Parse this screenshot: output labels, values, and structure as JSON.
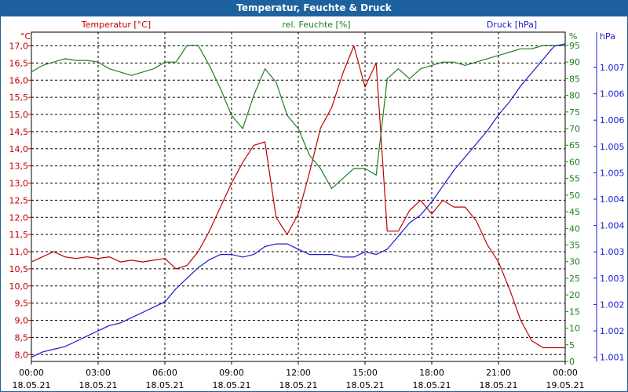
{
  "window": {
    "title": "Temperatur, Feuchte & Druck"
  },
  "colors": {
    "temperature": "#c00000",
    "humidity": "#1f7f1f",
    "pressure": "#1a1acf",
    "titlebar": "#1d619e",
    "grid": "#000000"
  },
  "chart_data": {
    "type": "line",
    "title": "Temperatur, Feuchte & Druck",
    "x_ticks": [
      {
        "time": "00:00",
        "date": "18.05.21"
      },
      {
        "time": "03:00",
        "date": "18.05.21"
      },
      {
        "time": "06:00",
        "date": "18.05.21"
      },
      {
        "time": "09:00",
        "date": "18.05.21"
      },
      {
        "time": "12:00",
        "date": "18.05.21"
      },
      {
        "time": "15:00",
        "date": "18.05.21"
      },
      {
        "time": "18:00",
        "date": "18.05.21"
      },
      {
        "time": "21:00",
        "date": "18.05.21"
      },
      {
        "time": "00:00",
        "date": "19.05.21"
      }
    ],
    "axes": {
      "temperature": {
        "label": "Temperatur [°C]",
        "unit": "°C",
        "ylim": [
          7.8,
          17.4
        ],
        "ticks": [
          "8,0",
          "8,5",
          "9,0",
          "9,5",
          "10,0",
          "10,5",
          "11,0",
          "11,5",
          "12,0",
          "12,5",
          "13,0",
          "13,5",
          "14,0",
          "14,5",
          "15,0",
          "15,5",
          "16,0",
          "16,5",
          "17,0"
        ]
      },
      "humidity": {
        "label": "rel. Feuchte [%]",
        "unit": "%",
        "ylim": [
          0,
          99
        ],
        "ticks": [
          "0",
          "5",
          "10",
          "15",
          "20",
          "25",
          "30",
          "35",
          "40",
          "45",
          "50",
          "55",
          "60",
          "65",
          "70",
          "75",
          "80",
          "85",
          "90",
          "95"
        ]
      },
      "pressure": {
        "label": "Druck [hPa]",
        "unit": "hPa",
        "ylim": [
          1000.92,
          1007.17
        ],
        "ticks": [
          "1.001",
          "1.002",
          "1.002",
          "1.003",
          "1.003",
          "1.004",
          "1.004",
          "1.005",
          "1.005",
          "1.006",
          "1.006",
          "1.007"
        ]
      }
    },
    "x_unit": "hours since 18.05.21 00:00",
    "grid": true,
    "series": [
      {
        "name": "Temperatur [°C]",
        "axis": "temperature",
        "x": [
          0,
          0.5,
          1,
          1.5,
          2,
          2.5,
          3,
          3.5,
          4,
          4.5,
          5,
          5.5,
          6,
          6.5,
          7,
          7.5,
          8,
          8.5,
          9,
          9.5,
          10,
          10.5,
          11,
          11.5,
          12,
          12.5,
          13,
          13.5,
          14,
          14.5,
          15,
          15.5,
          16,
          16.5,
          17,
          17.5,
          18,
          18.5,
          19,
          19.5,
          20,
          20.5,
          21,
          21.5,
          22,
          22.5,
          23,
          23.5,
          24
        ],
        "y": [
          10.7,
          10.85,
          11.0,
          10.85,
          10.8,
          10.85,
          10.8,
          10.85,
          10.7,
          10.75,
          10.7,
          10.75,
          10.8,
          10.5,
          10.6,
          11.0,
          11.6,
          12.3,
          13.0,
          13.6,
          14.1,
          14.2,
          12.0,
          11.5,
          12.1,
          13.3,
          14.6,
          15.2,
          16.2,
          17.0,
          15.8,
          16.5,
          11.6,
          11.6,
          12.2,
          12.5,
          12.1,
          12.5,
          12.3,
          12.3,
          11.9,
          11.2,
          10.7,
          9.9,
          9.0,
          8.4,
          8.2,
          8.2,
          8.2
        ]
      },
      {
        "name": "rel. Feuchte [%]",
        "axis": "humidity",
        "x": [
          0,
          0.5,
          1,
          1.5,
          2,
          2.5,
          3,
          3.5,
          4,
          4.5,
          5,
          5.5,
          6,
          6.5,
          7,
          7.5,
          8,
          8.5,
          9,
          9.5,
          10,
          10.5,
          11,
          11.5,
          12,
          12.5,
          13,
          13.5,
          14,
          14.5,
          15,
          15.5,
          16,
          16.5,
          17,
          17.5,
          18,
          18.5,
          19,
          19.5,
          20,
          20.5,
          21,
          21.5,
          22,
          22.5,
          23,
          23.5,
          24
        ],
        "y": [
          87,
          89,
          90,
          91,
          90.5,
          90.5,
          90,
          88,
          87,
          86,
          87,
          88,
          90,
          90,
          95,
          95,
          89,
          82,
          74,
          70,
          80,
          88,
          84,
          74,
          70,
          62,
          58,
          52,
          55,
          58,
          58,
          56,
          85,
          88,
          85,
          88,
          89,
          90,
          90,
          89,
          90,
          91,
          92,
          93,
          94,
          94,
          95,
          95,
          95
        ]
      },
      {
        "name": "Druck [hPa]",
        "axis": "pressure",
        "x": [
          0,
          0.5,
          1,
          1.5,
          2,
          2.5,
          3,
          3.5,
          4,
          4.5,
          5,
          5.5,
          6,
          6.5,
          7,
          7.5,
          8,
          8.5,
          9,
          9.5,
          10,
          10.5,
          11,
          11.5,
          12,
          12.5,
          13,
          13.5,
          14,
          14.5,
          15,
          15.5,
          16,
          16.5,
          17,
          17.5,
          18,
          18.5,
          19,
          19.5,
          20,
          20.5,
          21,
          21.5,
          22,
          22.5,
          23,
          23.5,
          24
        ],
        "y": [
          1001.0,
          1001.1,
          1001.15,
          1001.2,
          1001.3,
          1001.4,
          1001.5,
          1001.6,
          1001.65,
          1001.75,
          1001.85,
          1001.95,
          1002.05,
          1002.3,
          1002.5,
          1002.7,
          1002.85,
          1002.95,
          1002.95,
          1002.9,
          1002.95,
          1003.1,
          1003.15,
          1003.15,
          1003.05,
          1002.95,
          1002.95,
          1002.95,
          1002.9,
          1002.9,
          1003.0,
          1002.95,
          1003.05,
          1003.3,
          1003.55,
          1003.7,
          1003.95,
          1004.25,
          1004.55,
          1004.8,
          1005.05,
          1005.3,
          1005.6,
          1005.85,
          1006.15,
          1006.4,
          1006.65,
          1006.9,
          1006.95
        ]
      }
    ]
  }
}
